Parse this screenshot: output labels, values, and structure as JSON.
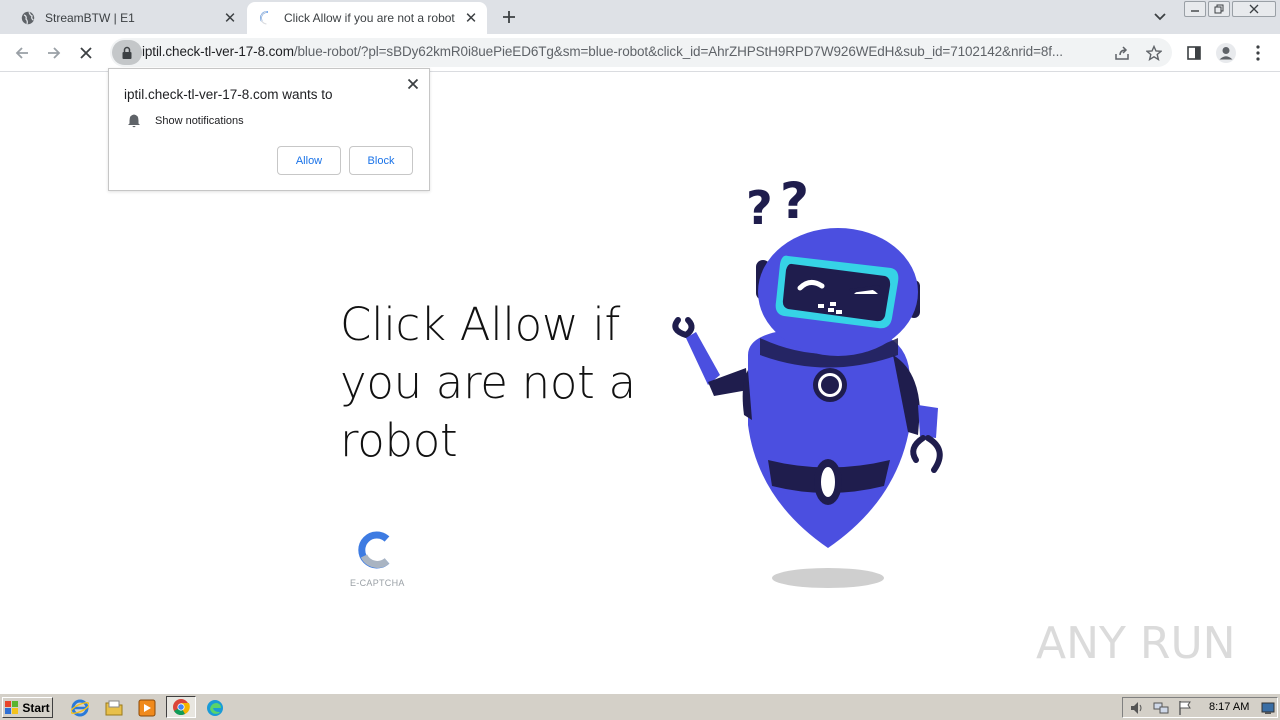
{
  "tabs": [
    {
      "title": "StreamBTW | E1"
    },
    {
      "title": "Click Allow if you are not a robot"
    }
  ],
  "address": {
    "host": "iptil.check-tl-ver-17-8.com",
    "path": "/blue-robot/?pl=sBDy62kmR0i8uePieED6Tg&sm=blue-robot&click_id=AhrZHPStH9RPD7W926WEdH&sub_id=7102142&nrid=8f..."
  },
  "permission_prompt": {
    "title": "iptil.check-tl-ver-17-8.com wants to",
    "permission": "Show notifications",
    "allow_label": "Allow",
    "block_label": "Block"
  },
  "page": {
    "headline": "Click Allow if you are not a robot",
    "captcha_label": "E-CAPTCHA",
    "watermark_text": "ANY RUN"
  },
  "taskbar": {
    "start_label": "Start",
    "clock": "8:17 AM"
  },
  "colors": {
    "robot_body": "#4b4fe0",
    "robot_dark": "#1f1d4d",
    "visor": "#36d3e6",
    "link_blue": "#1a73e8"
  },
  "icons": {
    "tab1": "globe-icon",
    "tab2": "loading-spinner-icon",
    "prompt": "bell-icon"
  }
}
